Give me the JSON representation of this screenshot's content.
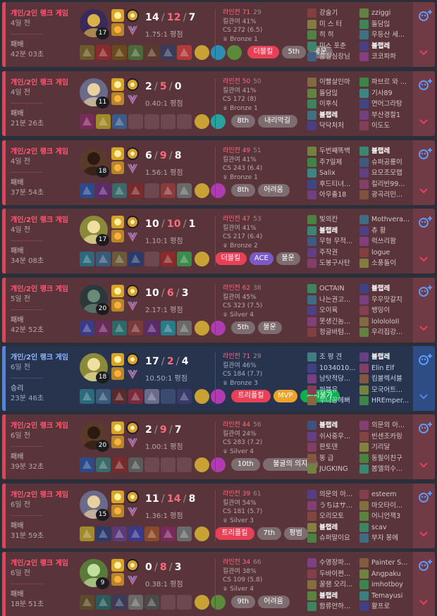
{
  "matches": [
    {
      "result": "loss",
      "queue": "개인/2인 랭크 게임",
      "ago": "4일 전",
      "outcome": "패배",
      "duration": "42분 03초",
      "level": "17",
      "kda": {
        "k": "14",
        "d": "12",
        "a": "7"
      },
      "ratio": "1.75:1 평점",
      "lane": "라인전 71",
      "lane_opp": "29",
      "kp": "킬관여 41%",
      "cs": "CS 272 (6.5)",
      "tier": "Bronze 1",
      "badges": [
        {
          "label": "더블킬",
          "color": "red"
        },
        {
          "label": "5th",
          "color": "gray"
        },
        {
          "label": "불운",
          "color": "gray"
        }
      ],
      "champ_color": "#3a2a5a",
      "champ_accent": "#d9b14a",
      "team1": [
        "강술기",
        "미 스 터",
        "히 히",
        "미스 포춘",
        "품질심장님"
      ],
      "team2": [
        "zziggi",
        "돌담읺",
        "우등산 세...",
        "블랩레",
        "코코파파"
      ],
      "me_side": 2,
      "me_idx": 3,
      "item_colors": [
        "#6b5a2a",
        "#8a2a2a",
        "#6b4a1a",
        "#4a6a3a",
        "#5a3a2a",
        "#3a3a5a",
        "#b33a3a"
      ],
      "item_empty": [],
      "ward": "#c9a235",
      "extra": [
        "#2a8fb0",
        "#5a8a3a"
      ]
    },
    {
      "result": "loss",
      "queue": "개인/2인 랭크 게임",
      "ago": "4일 전",
      "outcome": "패배",
      "duration": "21분 26초",
      "level": "11",
      "kda": {
        "k": "2",
        "d": "5",
        "a": "0"
      },
      "ratio": "0.40:1 평점",
      "lane": "라인전 50",
      "lane_opp": "50",
      "kp": "킬관여 41%",
      "cs": "CS 172 (8)",
      "tier": "Bronze 1",
      "badges": [
        {
          "label": "8th",
          "color": "gray"
        },
        {
          "label": "내리막길",
          "color": "gray"
        }
      ],
      "champ_color": "#6a6a8a",
      "champ_accent": "#e8d0a0",
      "team1": [
        "이빨살인마",
        "돌담읺",
        "이후식",
        "블랩레",
        "닥닥처처"
      ],
      "team2": [
        "파브르 와 ...",
        "기사89",
        "연어그라탕",
        "부산경찰1",
        "이도도"
      ],
      "me_side": 1,
      "me_idx": 3,
      "item_colors": [
        "#7a2a5a",
        "#a08a2a",
        "#3a5a8a",
        "",
        "",
        "",
        ""
      ],
      "item_empty": [
        3,
        4,
        5,
        6
      ],
      "ward": "#c9a235",
      "extra": [
        "#2aa0a0"
      ]
    },
    {
      "result": "loss",
      "queue": "개인/2인 랭크 게임",
      "ago": "4일 전",
      "outcome": "패배",
      "duration": "37분 54초",
      "level": "18",
      "kda": {
        "k": "6",
        "d": "9",
        "a": "8"
      },
      "ratio": "1.56:1 평점",
      "lane": "라인전 49",
      "lane_opp": "51",
      "kp": "킬관여 41%",
      "cs": "CS 243 (6.4)",
      "tier": "Bronze 1",
      "badges": [
        {
          "label": "8th",
          "color": "gray"
        },
        {
          "label": "어려움",
          "color": "gray"
        }
      ],
      "champ_color": "#5a3a2a",
      "champ_accent": "#2a1a10",
      "team1": [
        "두번째똑백",
        "주7일제",
        "Salix",
        "후드티녀...",
        "아우출18"
      ],
      "team2": [
        "블랩레",
        "슈퍼공룡이",
        "요모조모랩",
        "킬리빈99...",
        "광곡리민..."
      ],
      "me_side": 2,
      "me_idx": 0,
      "item_colors": [
        "#2a4a8a",
        "#5a2a6a",
        "#3a6a6a",
        "#7a2a2a",
        "",
        "#8a3a3a",
        "#6a6a6a"
      ],
      "item_empty": [
        4
      ],
      "ward": "#c9a235",
      "extra": [
        "#b03ab0"
      ]
    },
    {
      "result": "loss",
      "queue": "개인/2인 랭크 게임",
      "ago": "4일 전",
      "outcome": "패배",
      "duration": "34분 08초",
      "level": "17",
      "kda": {
        "k": "10",
        "d": "10",
        "a": "1"
      },
      "ratio": "1.10:1 평점",
      "lane": "라인전 47",
      "lane_opp": "53",
      "kp": "킬관여 41%",
      "cs": "CS 217 (6.4)",
      "tier": "Bronze 2",
      "badges": [
        {
          "label": "더블킬",
          "color": "red"
        },
        {
          "label": "ACE",
          "color": "purple"
        },
        {
          "label": "불운",
          "color": "gray"
        }
      ],
      "champ_color": "#8a8a3a",
      "champ_accent": "#f0e0a0",
      "team1": [
        "빛의칸",
        "블랩레",
        "무형 무적...",
        "주작권",
        "도봉구사탄"
      ],
      "team2": [
        "Mothvera...",
        "츄 황",
        "럭쓰리팜",
        "logue",
        "소풍돌이"
      ],
      "me_side": 1,
      "me_idx": 1,
      "item_colors": [
        "#2a6a7a",
        "#3a5a7a",
        "#6a5a3a",
        "#2a3a6a",
        "",
        "#8a2a2a",
        "#3a8a4a"
      ],
      "item_empty": [
        4
      ],
      "ward": "#c9a235",
      "extra": []
    },
    {
      "result": "loss",
      "queue": "개인/2인 랭크 게임",
      "ago": "5일 전",
      "outcome": "패배",
      "duration": "42분 52초",
      "level": "20",
      "kda": {
        "k": "10",
        "d": "6",
        "a": "3"
      },
      "ratio": "2.17:1 평점",
      "lane": "라인전 62",
      "lane_opp": "38",
      "kp": "킬관여 45%",
      "cs": "CS 323 (7.5)",
      "tier": "Silver 4",
      "badges": [
        {
          "label": "5th",
          "color": "gray"
        },
        {
          "label": "불운",
          "color": "gray"
        }
      ],
      "champ_color": "#2a3a3a",
      "champ_accent": "#6a8a7a",
      "team1": [
        "OCTAIN",
        "나는권고...",
        "오이육",
        "못생긴놈...",
        "정글바텀..."
      ],
      "team2": [
        "블랩레",
        "우우맛갈치",
        "뱅밍이",
        "lolololoII",
        "우리집강..."
      ],
      "me_side": 2,
      "me_idx": 0,
      "item_colors": [
        "#3a3a8a",
        "#6a2a5a",
        "#2a6a6a",
        "#7a3a3a",
        "#5a2a6a",
        "#2a7a8a",
        "#6a6a6a"
      ],
      "item_empty": [],
      "ward": "#c9a235",
      "extra": [
        "#b03ab0"
      ]
    },
    {
      "result": "win",
      "queue": "개인/2인 랭크 게임",
      "ago": "6일 전",
      "outcome": "승리",
      "duration": "23분 46초",
      "level": "18",
      "kda": {
        "k": "17",
        "d": "2",
        "a": "4"
      },
      "ratio": "10.50:1 평점",
      "lane": "라인전 71",
      "lane_opp": "29",
      "kp": "킬관여 46%",
      "cs": "CS 184 (7.7)",
      "tier": "Bronze 3",
      "badges": [
        {
          "label": "트리플킬",
          "color": "red"
        },
        {
          "label": "MVP",
          "color": "orange"
        },
        {
          "label": "저지불가",
          "color": "green"
        }
      ],
      "champ_color": "#8a8a3a",
      "champ_accent": "#f0e0a0",
      "team1": [
        "조 평 견",
        "1034010...",
        "남탓적당...",
        "퍼블유",
        "누나꽁헤뻐"
      ],
      "team2": [
        "블랩레",
        "Elin Elf",
        "킴볼렉서블",
        "모국어트...",
        "HREmper..."
      ],
      "me_side": 2,
      "me_idx": 0,
      "item_colors": [
        "#2a6a7a",
        "#3a5a7a",
        "#5a2a2a",
        "#7a2a3a",
        "#6a6a8a",
        "",
        "#3a3a6a"
      ],
      "item_empty": [
        5
      ],
      "ward": "#c9a235",
      "extra": [
        "#b03ab0"
      ]
    },
    {
      "result": "loss",
      "queue": "개인/2인 랭크 게임",
      "ago": "6일 전",
      "outcome": "패배",
      "duration": "39분 32초",
      "level": "20",
      "kda": {
        "k": "2",
        "d": "9",
        "a": "7"
      },
      "ratio": "1.00:1 평점",
      "lane": "라인전 44",
      "lane_opp": "56",
      "kp": "킬관여 24%",
      "cs": "CS 283 (7.2)",
      "tier": "Silver 4",
      "badges": [
        {
          "label": "10th",
          "color": "gray"
        },
        {
          "label": "불굴의 의지",
          "color": "gray"
        }
      ],
      "champ_color": "#5a3a2a",
      "champ_accent": "#2a1a10",
      "team1": [
        "블랩레",
        "쉬사중우...",
        "판토덴",
        "똥 급",
        "JUGKING"
      ],
      "team2": [
        "의문의 아...",
        "빈센조카링",
        "기리달",
        "동필이친구",
        "봄엘의수..."
      ],
      "me_side": 1,
      "me_idx": 0,
      "item_colors": [
        "#2a4a8a",
        "#3a6a6a",
        "#7a2a2a",
        "#5a5a5a",
        "",
        "",
        ""
      ],
      "item_empty": [
        4,
        5
      ],
      "ward": "#c9a235",
      "extra": [
        "#b03ab0"
      ]
    },
    {
      "result": "loss",
      "queue": "개인/2인 랭크 게임",
      "ago": "6일 전",
      "outcome": "패배",
      "duration": "31분 59초",
      "level": "15",
      "kda": {
        "k": "11",
        "d": "14",
        "a": "8"
      },
      "ratio": "1.36:1 평점",
      "lane": "라인전 39",
      "lane_opp": "61",
      "kp": "킬관여 54%",
      "cs": "CS 181 (5.7)",
      "tier": "Silver 3",
      "badges": [
        {
          "label": "트리플킬",
          "color": "red"
        },
        {
          "label": "7th",
          "color": "gray"
        },
        {
          "label": "평범",
          "color": "gray"
        }
      ],
      "champ_color": "#6a6a8a",
      "champ_accent": "#e8d0a0",
      "team1": [
        "의문의 아...",
        "うちはサ...",
        "오리모토",
        "블랩레",
        "슈퍼말이요"
      ],
      "team2": [
        "esteem",
        "마오타이...",
        "어니언잭3",
        "scav",
        "부자 몽에"
      ],
      "me_side": 1,
      "me_idx": 3,
      "item_colors": [
        "#a08a2a",
        "#2a3a6a",
        "#5a3a7a",
        "#3a3a8a",
        "#8a4a2a",
        "#7a2a5a",
        "#6a6a6a"
      ],
      "item_empty": [],
      "ward": "#c9a235",
      "extra": []
    },
    {
      "result": "loss",
      "queue": "개인/2인 랭크 게임",
      "ago": "6일 전",
      "outcome": "패배",
      "duration": "18분 51초",
      "level": "9",
      "kda": {
        "k": "0",
        "d": "8",
        "a": "3"
      },
      "ratio": "0.38:1 평점",
      "lane": "라인전 34",
      "lane_opp": "66",
      "kp": "킬관여 38%",
      "cs": "CS 109 (5.8)",
      "tier": "Silver 4",
      "badges": [
        {
          "label": "9th",
          "color": "gray"
        },
        {
          "label": "어려움",
          "color": "gray"
        }
      ],
      "champ_color": "#5a7a3a",
      "champ_accent": "#c0e0a0",
      "team1": [
        "수영장파...",
        "두바이쩐...",
        "꿀잼 오리...",
        "블랩레",
        "함류안하..."
      ],
      "team2": [
        "Painter S...",
        "Angpaku",
        "imhotboy",
        "Temayusi",
        "왈프로"
      ],
      "me_side": 1,
      "me_idx": 3,
      "item_colors": [
        "#5a4a2a",
        "#2a5a5a",
        "#3a3a5a",
        "#6a6a6a",
        "#4a4a4a",
        "",
        ""
      ],
      "item_empty": [
        5,
        6
      ],
      "ward": "#c9a235",
      "extra": [
        "#5a8a3a"
      ]
    }
  ],
  "icons": {
    "add": "add-favorite-icon",
    "expand": "chevron-down-icon"
  }
}
